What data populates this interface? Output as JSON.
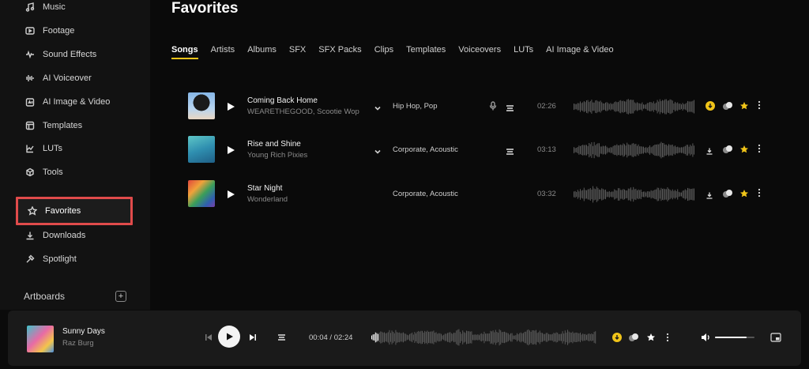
{
  "sidebar": {
    "items": [
      {
        "label": "Music",
        "icon": "music-note-icon"
      },
      {
        "label": "Footage",
        "icon": "film-icon"
      },
      {
        "label": "Sound Effects",
        "icon": "soundwave-icon"
      },
      {
        "label": "AI Voiceover",
        "icon": "ai-voiceover-icon"
      },
      {
        "label": "AI Image & Video",
        "icon": "ai-image-icon"
      },
      {
        "label": "Templates",
        "icon": "templates-icon"
      },
      {
        "label": "LUTs",
        "icon": "luts-icon"
      },
      {
        "label": "Tools",
        "icon": "tools-icon"
      },
      {
        "label": "Favorites",
        "icon": "star-outline-icon",
        "active": true
      },
      {
        "label": "Downloads",
        "icon": "download-icon"
      },
      {
        "label": "Spotlight",
        "icon": "spotlight-icon"
      }
    ],
    "artboards_label": "Artboards",
    "add_label": "+"
  },
  "main": {
    "title": "Favorites",
    "tabs": [
      "Songs",
      "Artists",
      "Albums",
      "SFX",
      "SFX Packs",
      "Clips",
      "Templates",
      "Voiceovers",
      "LUTs",
      "AI Image & Video"
    ],
    "active_tab": "Songs",
    "songs": [
      {
        "title": "Coming Back Home",
        "artist": "WEARETHEGOOD, Scootie Wop",
        "genre": "Hip Hop, Pop",
        "duration": "02:26",
        "downloaded": true,
        "has_vocals": true,
        "expandable": true
      },
      {
        "title": "Rise and Shine",
        "artist": "Young Rich Pixies",
        "genre": "Corporate, Acoustic",
        "duration": "03:13",
        "downloaded": false,
        "has_vocals": false,
        "expandable": true
      },
      {
        "title": "Star Night",
        "artist": "Wonderland",
        "genre": "Corporate, Acoustic",
        "duration": "03:32",
        "downloaded": false,
        "has_vocals": false,
        "expandable": false
      }
    ]
  },
  "player": {
    "title": "Sunny Days",
    "artist": "Raz Burg",
    "time": "00:04 / 02:24",
    "progress": 0.03,
    "volume": 0.8
  },
  "colors": {
    "accent": "#f0c419",
    "highlight_border": "#e04b4b"
  }
}
